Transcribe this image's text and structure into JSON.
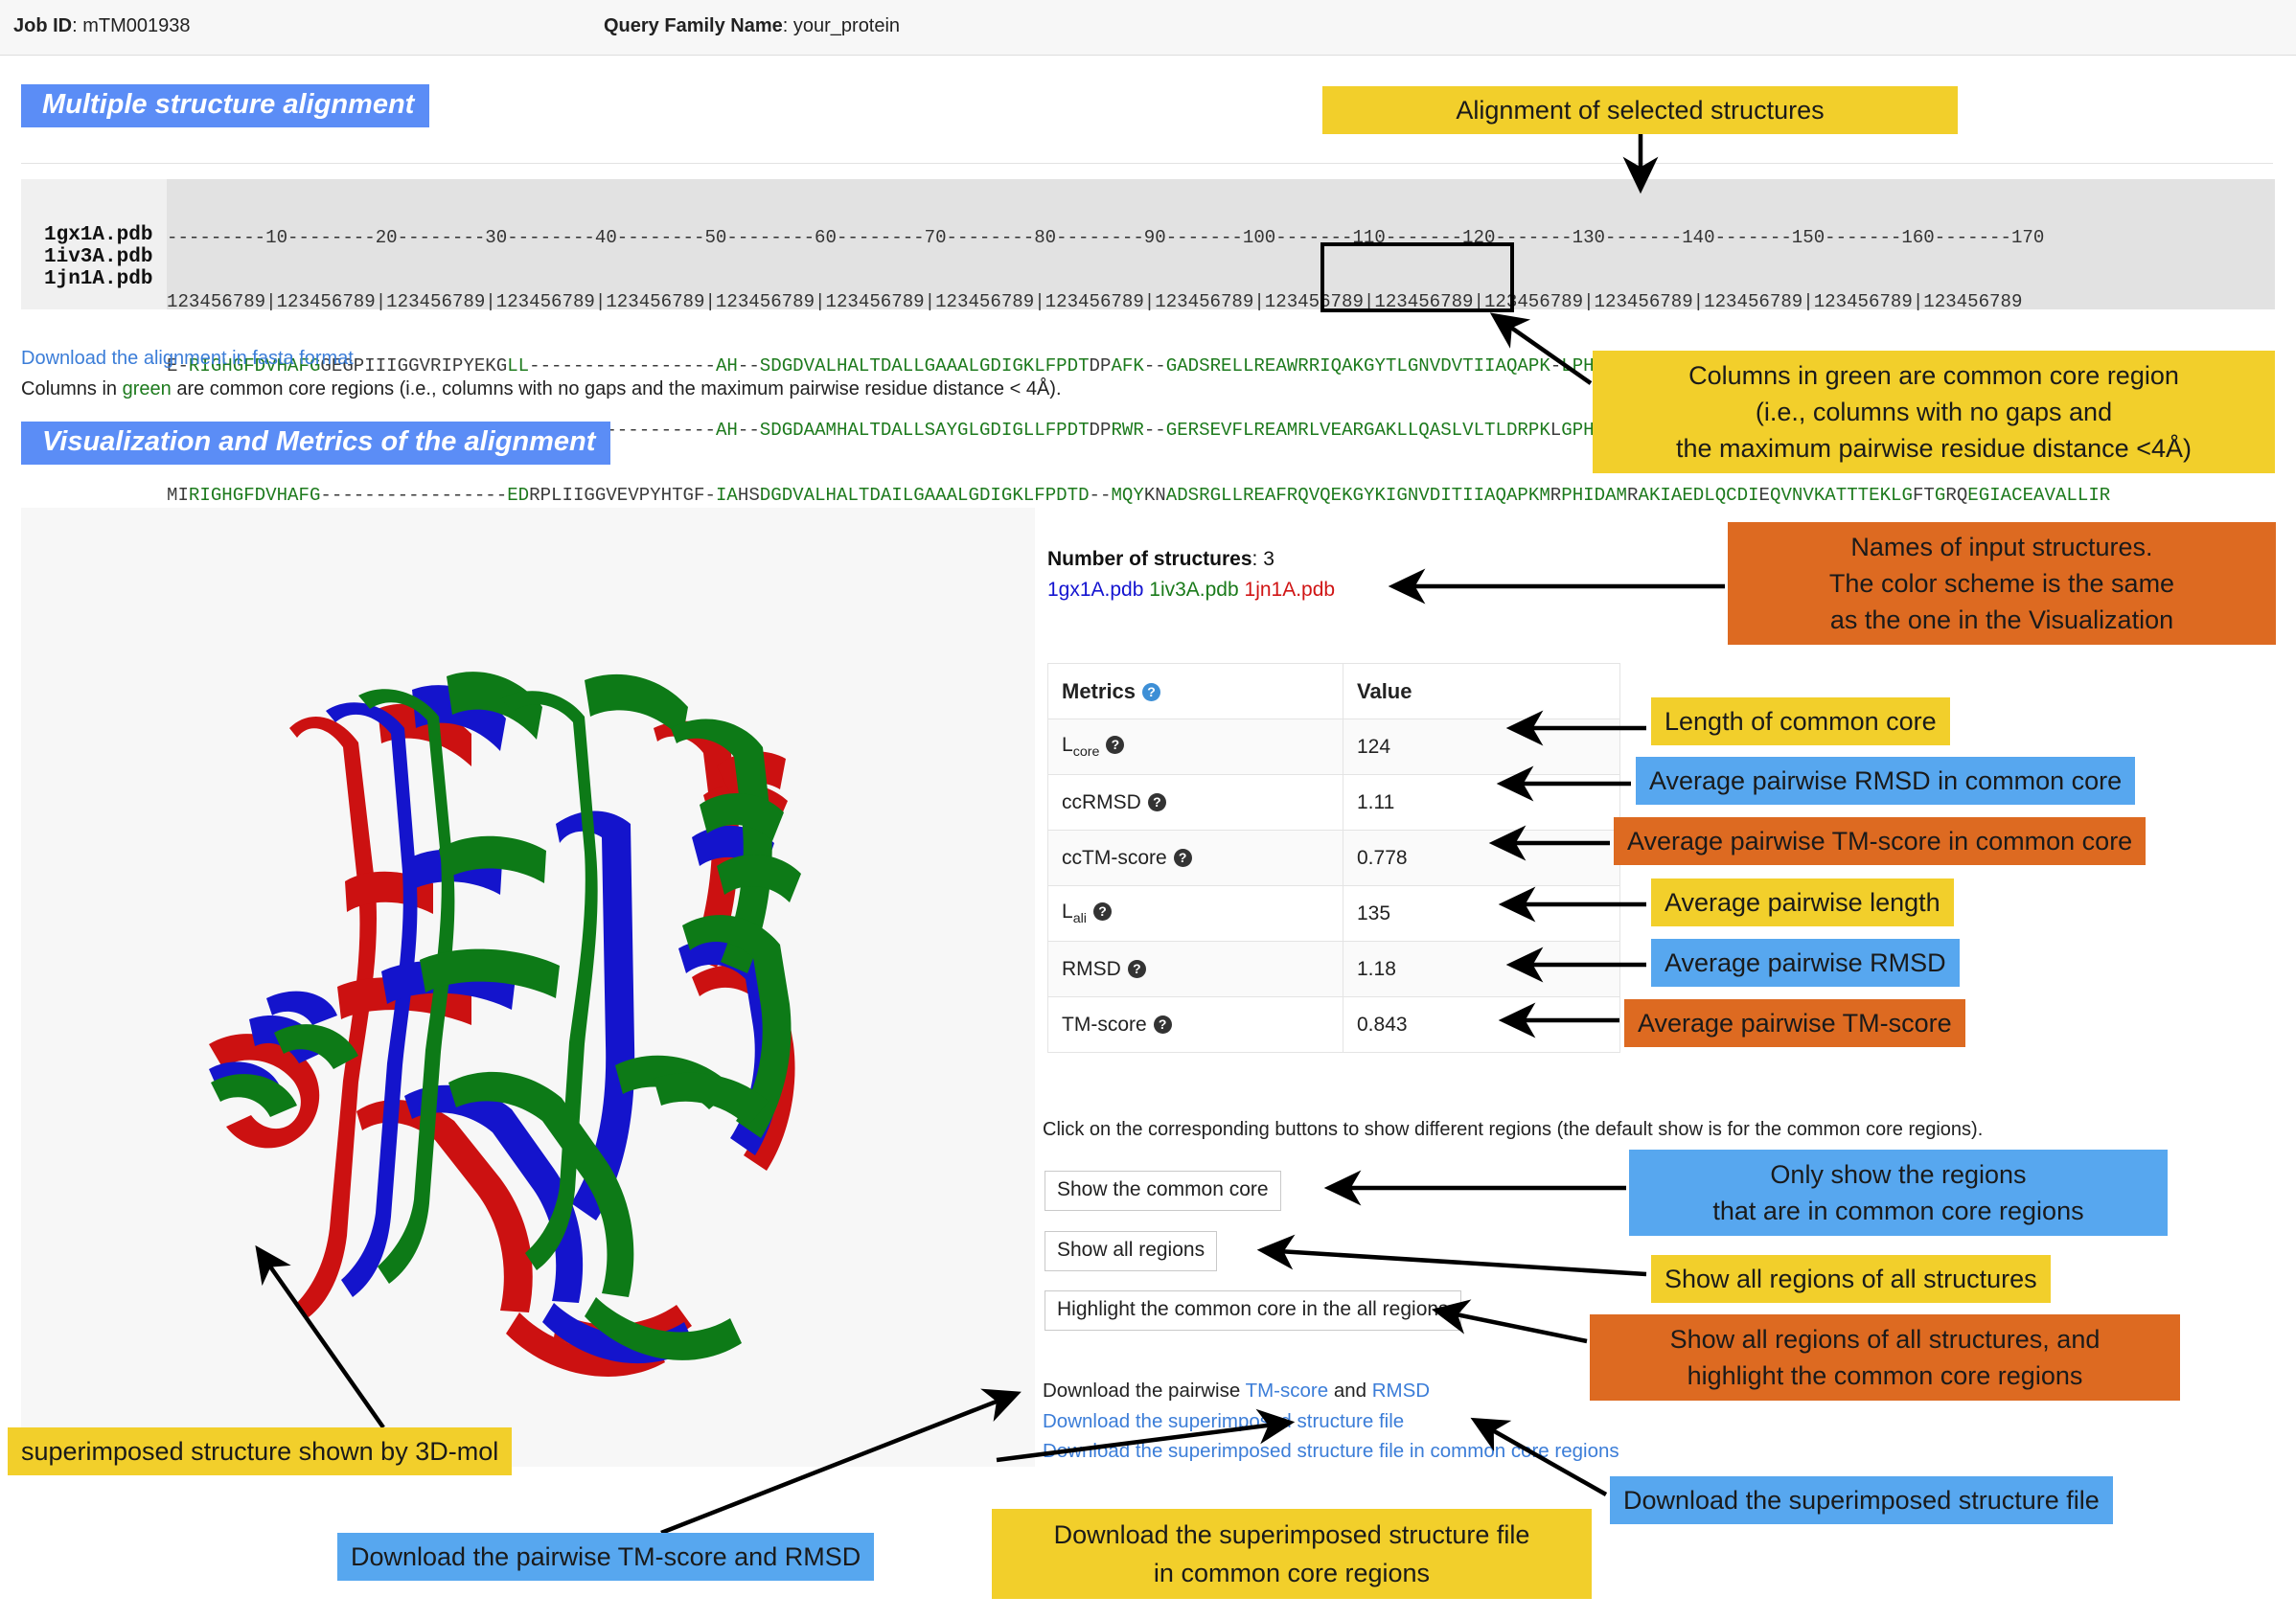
{
  "header": {
    "job_id_label": "Job ID",
    "job_id_value": "mTM001938",
    "query_family_label": "Query Family Name",
    "query_family_value": "your_protein"
  },
  "sections": {
    "alignment_title": "Multiple structure alignment",
    "visualization_title": "Visualization and Metrics of the alignment"
  },
  "alignment": {
    "names": [
      "1gx1A.pdb",
      "1iv3A.pdb",
      "1jn1A.pdb"
    ],
    "ruler_ticks": "---------10--------20--------30--------40--------50--------60--------70--------80--------90-------100-------110-------120-------130-------140-------150-------160-------170",
    "ruler_digits": "123456789|123456789|123456789|123456789|123456789|123456789|123456789|123456789|123456789|123456789|123456789|123456789|123456789|123456789|123456789|123456789|123456789",
    "sequences": [
      "E-RIGHGFDVHAFGGEGPIIIGGVRIPYEKGLL-----------------AH--SDGDVALHALTDALLGAAALGDIGKLFPDTDPAFK--GADSRELLREAWRRIQAKGYTLGNVDVTIIAQAPK-LPHIPQ-RVFIAEDLGCH-DDVNVKATTTEKLGFTGRGEGIACEAVALLIK",
      "--RIGYGEDSHRLEEGRPLYLCGLLIPSPVGAL-----------------AH--SDGDAAMHALTDALLSAYGLGDIGLLFPDTDPRWR--GERSEVFLREAMRLVEARGAKLLQASLVLTLDRPKLGPHRKALVDSLSRLMRLPQDRIGLTFKTSEGL--A--PSHVQARAVVLLD-",
      "MIRIGHGFDVHAFG-----------------EDRPLIIGGVEVPYHTGF-IAHSDGDVALHALTDAILGAAALGDIGKLFPDTD--MQYKNADSRGLLREAFRQVQEKGYKIGNVDITIIAQAPKMRPHIDAMRAKIAEDLQCDIEQVNVKATTTEKLGFTGRQEGIACEAVALLIR"
    ],
    "download_fasta_link": "Download the alignment in fasta format",
    "green_note_pre": "Columns in ",
    "green_note_word": "green",
    "green_note_post": " are common core regions (i.e., columns with no gaps and the maximum pairwise residue distance < 4Å)."
  },
  "metrics_panel": {
    "number_of_structures_label": "Number of structures",
    "number_of_structures_value": "3",
    "structure_names": [
      "1gx1A.pdb",
      "1iv3A.pdb",
      "1jn1A.pdb"
    ],
    "structure_colors": [
      "#1414d0",
      "#1a7a1a",
      "#d01414"
    ],
    "table_headers": [
      "Metrics",
      "Value"
    ],
    "rows": [
      {
        "metric": "L",
        "sub": "core",
        "value": "124"
      },
      {
        "metric": "ccRMSD",
        "sub": "",
        "value": "1.11"
      },
      {
        "metric": "ccTM-score",
        "sub": "",
        "value": "0.778"
      },
      {
        "metric": "L",
        "sub": "ali",
        "value": "135"
      },
      {
        "metric": "RMSD",
        "sub": "",
        "value": "1.18"
      },
      {
        "metric": "TM-score",
        "sub": "",
        "value": "0.843"
      }
    ]
  },
  "controls": {
    "note": "Click on the corresponding buttons to show different regions (the default show is for the common core regions).",
    "buttons": [
      "Show the common core",
      "Show all regions",
      "Highlight the common core in the all regions"
    ],
    "downloads": {
      "pairwise_prefix": "Download the pairwise ",
      "pairwise_tm": "TM-score",
      "pairwise_and": " and ",
      "pairwise_rmsd": "RMSD",
      "superimposed": "Download the superimposed structure file",
      "superimposed_core": "Download the superimposed structure file in common core regions"
    }
  },
  "callouts": {
    "alignment_of_selected": "Alignment of selected structures",
    "green_columns_l1": "Columns in green are common core region",
    "green_columns_l2": "(i.e., columns with no gaps and",
    "green_columns_l3": "the maximum pairwise residue distance <4Å)",
    "names_of_input_l1": "Names of input structures.",
    "names_of_input_l2": "The color scheme is the same",
    "names_of_input_l3": "as the one in the Visualization",
    "length_of_common_core": "Length of common core",
    "avg_pairwise_rmsd_core": "Average pairwise RMSD in common core",
    "avg_pairwise_tm_core": "Average pairwise TM-score in common core",
    "avg_pairwise_length": "Average pairwise length",
    "avg_pairwise_rmsd": "Average pairwise RMSD",
    "avg_pairwise_tm": "Average pairwise TM-score",
    "only_show_l1": "Only show the regions",
    "only_show_l2": "that are in common core regions",
    "show_all_regions": "Show all regions of all structures",
    "highlight_l1": "Show all regions of all structures, and",
    "highlight_l2": "highlight the common core regions",
    "download_superimposed": "Download the superimposed structure file",
    "superimposed_3dmol": "superimposed structure shown by 3D-mol",
    "download_pairwise": "Download the pairwise TM-score and RMSD",
    "download_common_l1": "Download the superimposed structure file",
    "download_common_l2": "in common core regions"
  },
  "colors": {
    "header_blue": "#5b8df6",
    "callout_yellow": "#f2cf2b",
    "callout_blue": "#57a7ef",
    "callout_orange": "#dd6a21",
    "core_green": "#1d7a1d",
    "link_blue": "#3b7dd8"
  }
}
